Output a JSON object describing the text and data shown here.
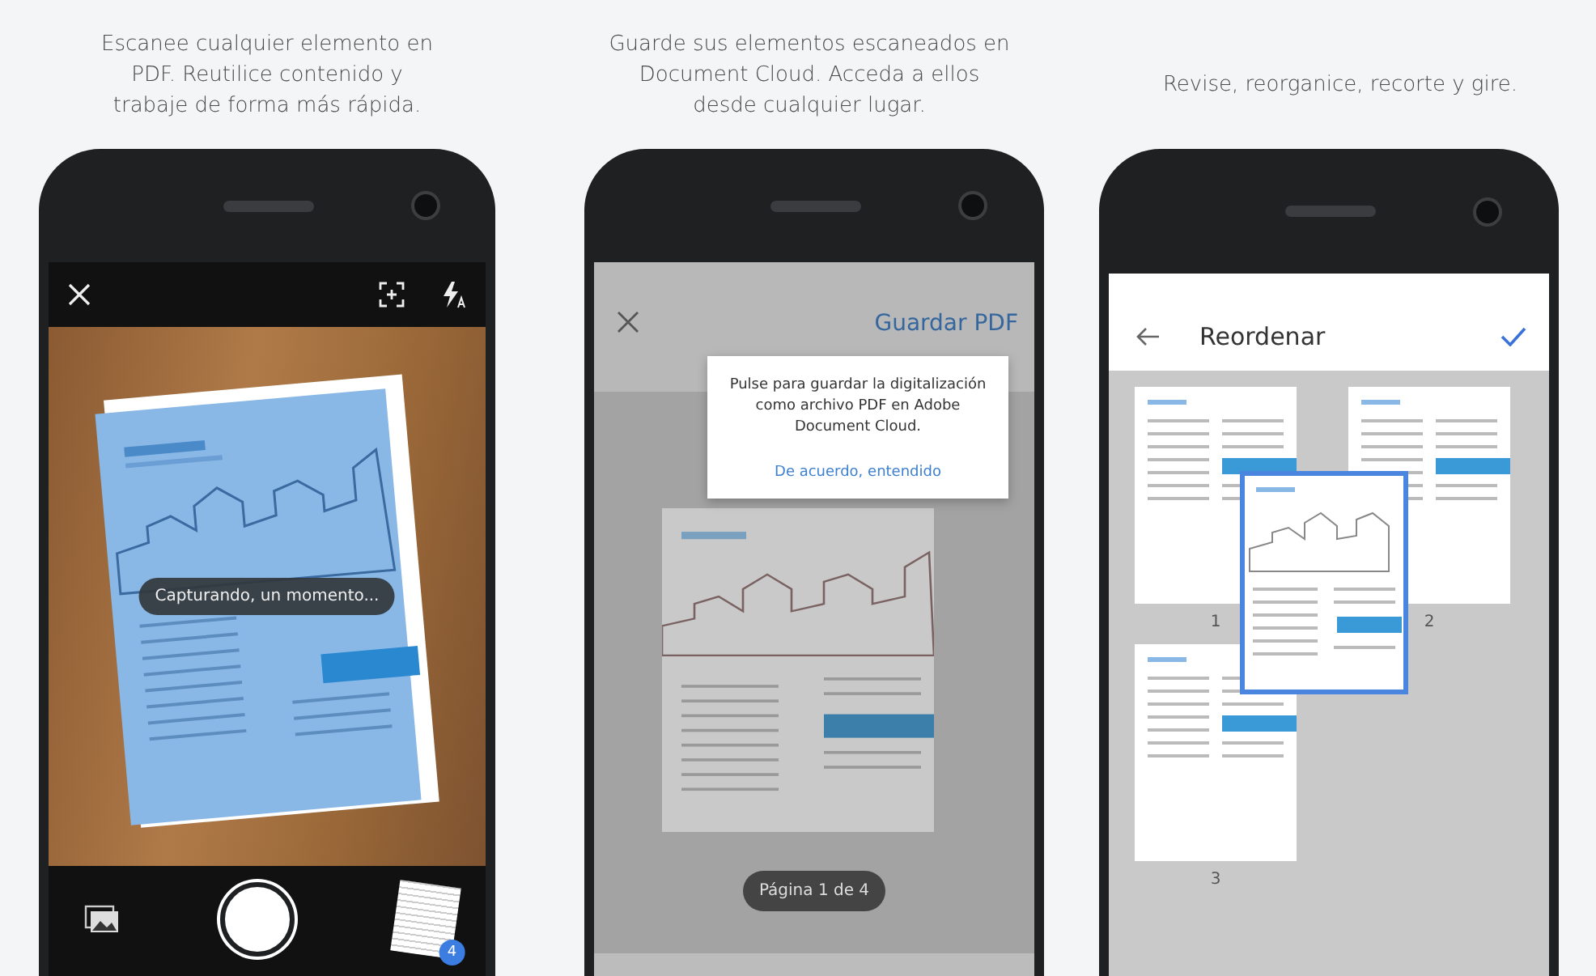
{
  "panels": [
    {
      "kind": "capture",
      "caption": "Escanee cualquier elemento en PDF. Reutilice contenido y trabaje de forma más rápida.",
      "toast": "Capturando, un momento...",
      "badge": "4"
    },
    {
      "kind": "save",
      "caption": "Guarde sus elementos escaneados en Document Cloud. Acceda a ellos desde cualquier lugar.",
      "action": "Guardar PDF",
      "tooltip": {
        "text": "Pulse para guardar la digitalización como archivo PDF en Adobe Document Cloud.",
        "link": "De acuerdo, entendido"
      },
      "page_indicator": "Página 1 de 4"
    },
    {
      "kind": "reorder",
      "caption": "Revise, reorganice, recorte y gire.",
      "title": "Reordenar",
      "pages": [
        "1",
        "2",
        "3"
      ]
    }
  ]
}
